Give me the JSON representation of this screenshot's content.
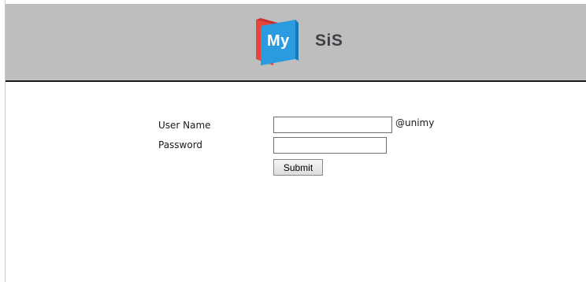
{
  "header": {
    "logo": {
      "part1": "My",
      "part2": "SiS",
      "colors": {
        "red_panel": "#e8453c",
        "blue_panel": "#2b9be0",
        "text_dark": "#3f3f44"
      }
    },
    "background_color": "#bebebf"
  },
  "login_form": {
    "username_label": "User Name",
    "username_value": "",
    "username_suffix": "@unimy",
    "password_label": "Password",
    "password_value": "",
    "submit_label": "Submit"
  }
}
